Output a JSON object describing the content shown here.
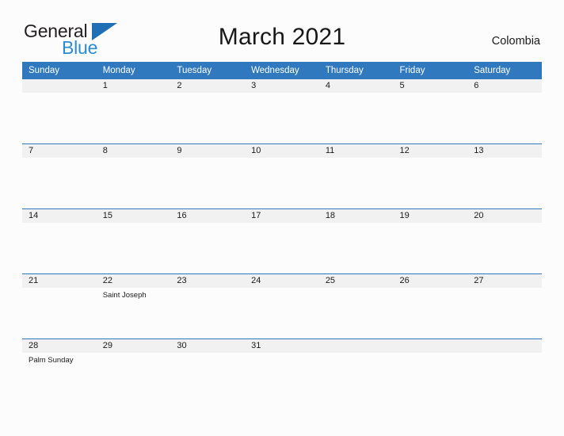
{
  "brand": {
    "name_part1": "General",
    "name_part2": "Blue",
    "flag_icon": "flag-triangle-icon"
  },
  "header": {
    "title": "March 2021",
    "country": "Colombia"
  },
  "colors": {
    "header_blue": "#3079be",
    "rule_blue": "#2f78bd",
    "date_band_gray": "#f1f1f1",
    "logo_blue": "#2b8bd4",
    "page_background": "#fcfcfd"
  },
  "calendar": {
    "month": "March",
    "year": "2021",
    "weekday_headers": [
      "Sunday",
      "Monday",
      "Tuesday",
      "Wednesday",
      "Thursday",
      "Friday",
      "Saturday"
    ],
    "weeks": [
      {
        "days": [
          {
            "date": "",
            "events": []
          },
          {
            "date": "1",
            "events": []
          },
          {
            "date": "2",
            "events": []
          },
          {
            "date": "3",
            "events": []
          },
          {
            "date": "4",
            "events": []
          },
          {
            "date": "5",
            "events": []
          },
          {
            "date": "6",
            "events": []
          }
        ]
      },
      {
        "days": [
          {
            "date": "7",
            "events": []
          },
          {
            "date": "8",
            "events": []
          },
          {
            "date": "9",
            "events": []
          },
          {
            "date": "10",
            "events": []
          },
          {
            "date": "11",
            "events": []
          },
          {
            "date": "12",
            "events": []
          },
          {
            "date": "13",
            "events": []
          }
        ]
      },
      {
        "days": [
          {
            "date": "14",
            "events": []
          },
          {
            "date": "15",
            "events": []
          },
          {
            "date": "16",
            "events": []
          },
          {
            "date": "17",
            "events": []
          },
          {
            "date": "18",
            "events": []
          },
          {
            "date": "19",
            "events": []
          },
          {
            "date": "20",
            "events": []
          }
        ]
      },
      {
        "days": [
          {
            "date": "21",
            "events": []
          },
          {
            "date": "22",
            "events": [
              "Saint Joseph"
            ]
          },
          {
            "date": "23",
            "events": []
          },
          {
            "date": "24",
            "events": []
          },
          {
            "date": "25",
            "events": []
          },
          {
            "date": "26",
            "events": []
          },
          {
            "date": "27",
            "events": []
          }
        ]
      },
      {
        "days": [
          {
            "date": "28",
            "events": [
              "Palm Sunday"
            ]
          },
          {
            "date": "29",
            "events": []
          },
          {
            "date": "30",
            "events": []
          },
          {
            "date": "31",
            "events": []
          },
          {
            "date": "",
            "events": []
          },
          {
            "date": "",
            "events": []
          },
          {
            "date": "",
            "events": []
          }
        ]
      }
    ]
  }
}
